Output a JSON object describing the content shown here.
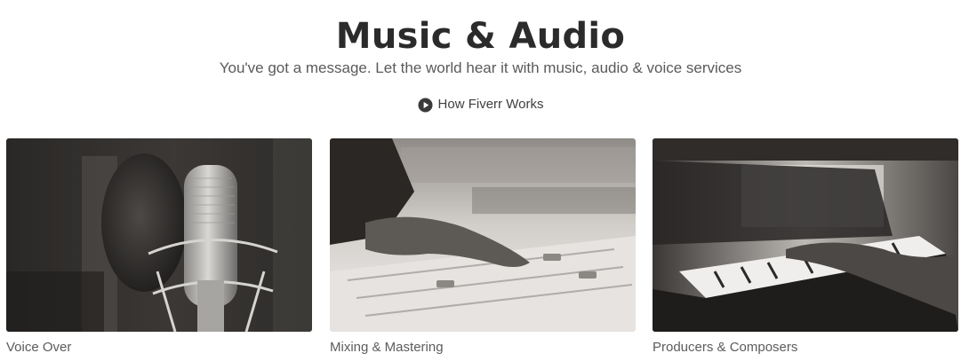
{
  "header": {
    "title": "Music & Audio",
    "subtitle": "You've got a message. Let the world hear it with music, audio & voice services",
    "how_link_label": "How Fiverr Works",
    "how_link_icon": "play-circle-icon"
  },
  "categories": [
    {
      "label": "Voice Over",
      "image": "studio-microphone-photo"
    },
    {
      "label": "Mixing & Mastering",
      "image": "mixing-console-photo"
    },
    {
      "label": "Producers & Composers",
      "image": "piano-keys-photo"
    }
  ]
}
